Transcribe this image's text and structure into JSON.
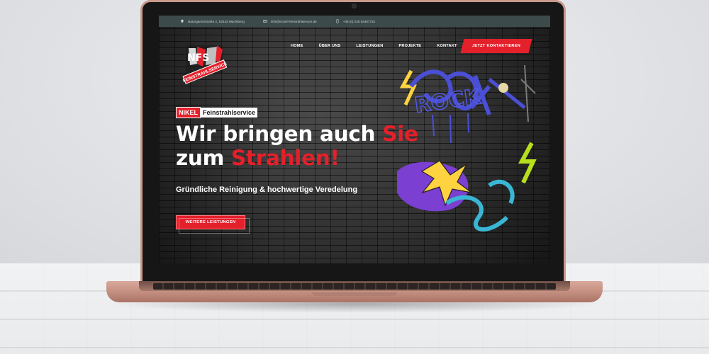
{
  "topbar": {
    "address": "Naturgartenstraße 2, 53343 Wachtberg",
    "email": "info@nickel-feinstrahlservice.de",
    "phone": "+49 (0) 228 93487734"
  },
  "nav": {
    "items": [
      "HOME",
      "ÜBER UNS",
      "LEISTUNGEN",
      "PROJEKTE",
      "KONTAKT"
    ],
    "cta": "JETZT KONTAKTIEREN"
  },
  "logo": {
    "text": "FEINSTRAHLSERVICE"
  },
  "hero": {
    "brand_red": "NIKEL",
    "brand_rest": "Feinstrahlservice",
    "headline_part1": "Wir bringen auch ",
    "headline_red1": "Sie",
    "headline_part2": "zum ",
    "headline_red2": "Strahlen!",
    "subline": "Gründliche Reinigung & hochwertige Veredelung",
    "button": "WEITERE LEISTUNGEN",
    "graffiti_text": "ROCK"
  },
  "colors": {
    "accent": "#e4202b",
    "topbar_bg": "#3d4a4c",
    "laptop": "#c99a8c"
  },
  "icons": [
    "map-pin-icon",
    "mail-icon",
    "phone-icon"
  ]
}
